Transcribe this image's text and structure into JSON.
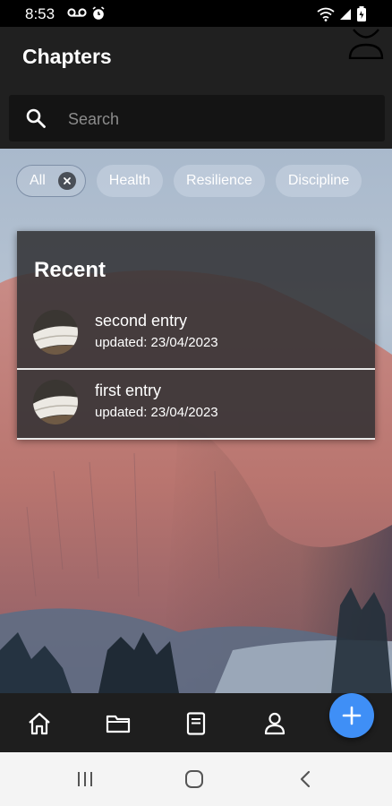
{
  "status_bar": {
    "time": "8:53",
    "left_icons": [
      "voicemail-icon",
      "alarm-icon"
    ],
    "right_icons": [
      "wifi-icon",
      "signal-icon",
      "battery-icon"
    ]
  },
  "header": {
    "title": "Chapters",
    "profile_icon": "person-outline-icon"
  },
  "search": {
    "placeholder": "Search",
    "value": ""
  },
  "chips": [
    {
      "label": "All",
      "selected": true
    },
    {
      "label": "Health",
      "selected": false
    },
    {
      "label": "Resilience",
      "selected": false
    },
    {
      "label": "Discipline",
      "selected": false
    }
  ],
  "recent": {
    "title": "Recent",
    "entries": [
      {
        "title": "second entry",
        "updated": "updated: 23/04/2023"
      },
      {
        "title": "first entry",
        "updated": "updated: 23/04/2023"
      }
    ]
  },
  "bottom_nav": {
    "items": [
      "home-icon",
      "folder-icon",
      "notebook-icon",
      "profile-icon"
    ],
    "fab_icon": "plus-icon"
  },
  "system_nav": [
    "recents-icon",
    "home-icon",
    "back-icon"
  ],
  "colors": {
    "accent": "#3f8ff6",
    "header_bg": "#202020",
    "card_bg": "#303032"
  }
}
